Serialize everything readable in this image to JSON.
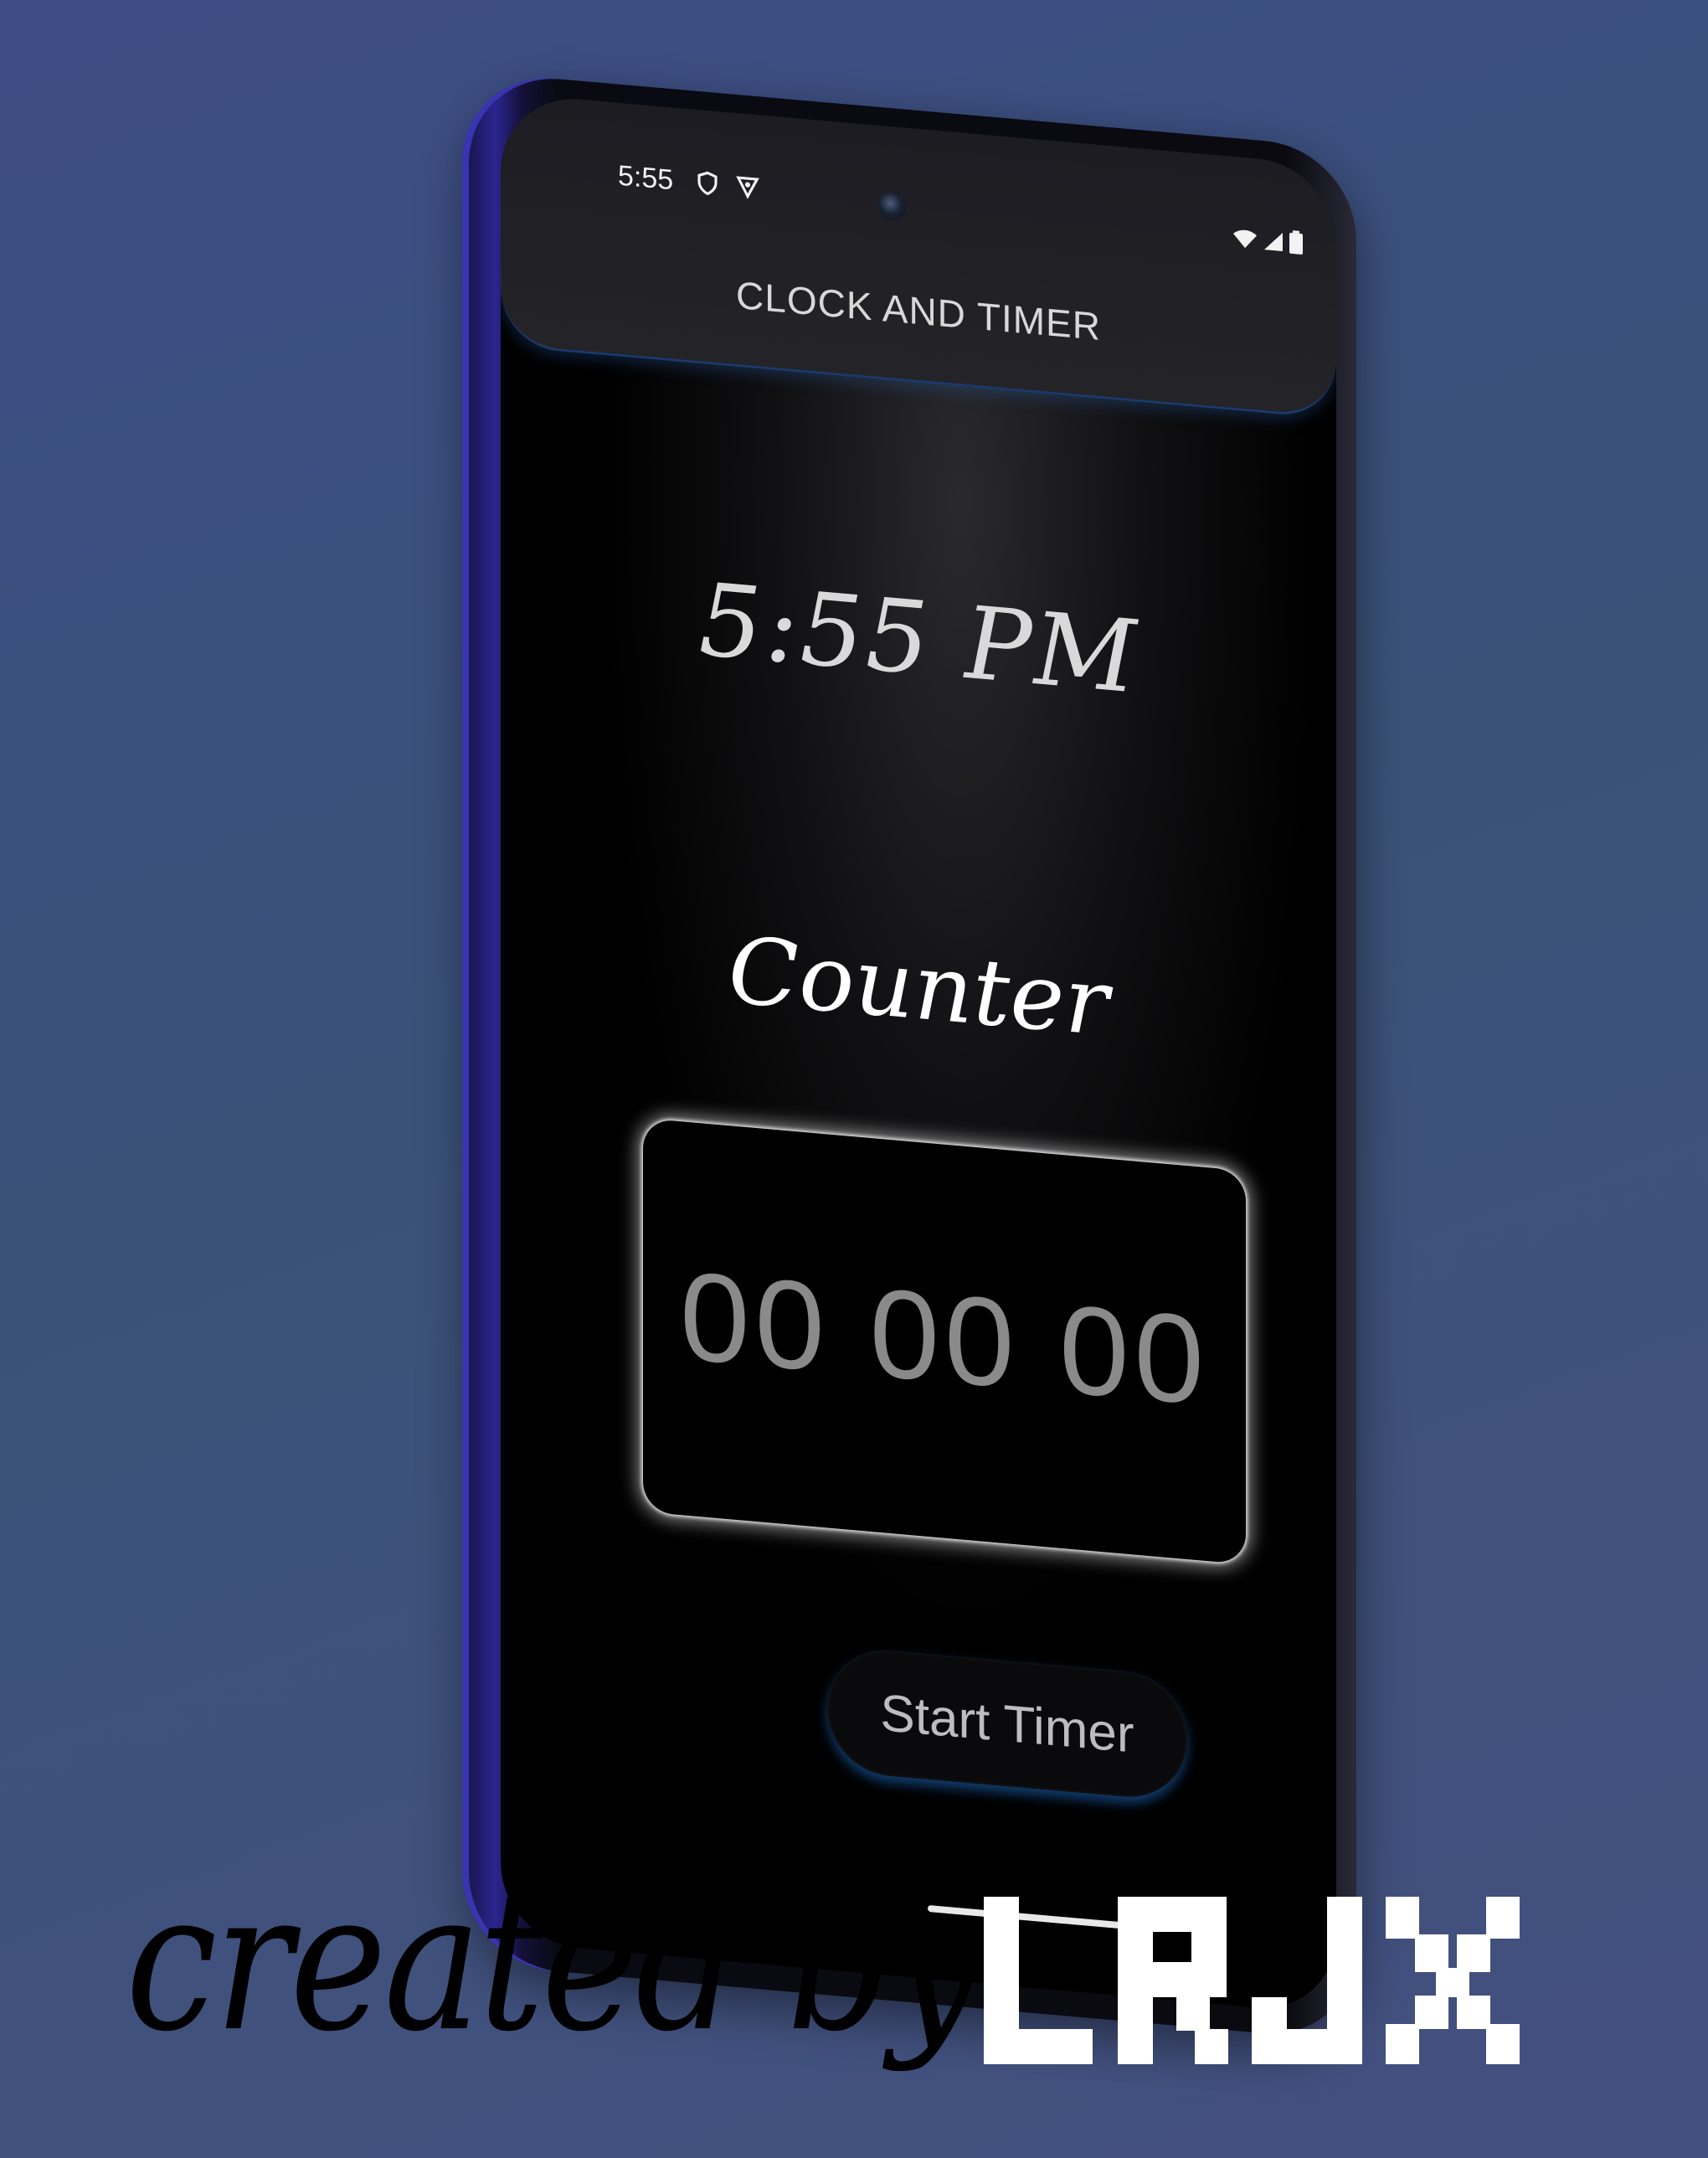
{
  "status_bar": {
    "time": "5:55"
  },
  "app_bar": {
    "title": "CLOCK AND TIMER"
  },
  "clock": {
    "time": "5:55 PM"
  },
  "counter": {
    "label": "Counter",
    "value": "00 00 00"
  },
  "actions": {
    "start_label": "Start Timer"
  },
  "watermark": {
    "text": "created by",
    "logo_text": "LRJX"
  },
  "colors": {
    "background": "#3e4d86",
    "screen": "#000000",
    "accent_glow": "#1e6ec8",
    "counter_text": "#8a8a8a"
  }
}
